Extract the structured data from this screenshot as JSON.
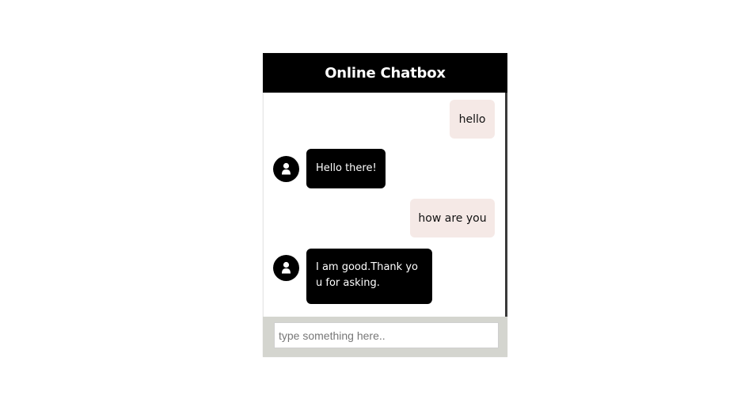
{
  "header": {
    "title": "Online Chatbox"
  },
  "messages": [
    {
      "sender": "user",
      "text": "hello"
    },
    {
      "sender": "bot",
      "text": "Hello there!"
    },
    {
      "sender": "user",
      "text": "how are you"
    },
    {
      "sender": "bot",
      "text_line1": "I am good.Thank yo",
      "text_line2": "u for asking."
    }
  ],
  "input": {
    "placeholder": "type something here..",
    "value": ""
  },
  "icons": {
    "avatar": "user-icon"
  },
  "colors": {
    "header_bg": "#000000",
    "user_bubble": "#f5e9e6",
    "bot_bubble": "#000000",
    "footer_bg": "#d4d5cf"
  }
}
